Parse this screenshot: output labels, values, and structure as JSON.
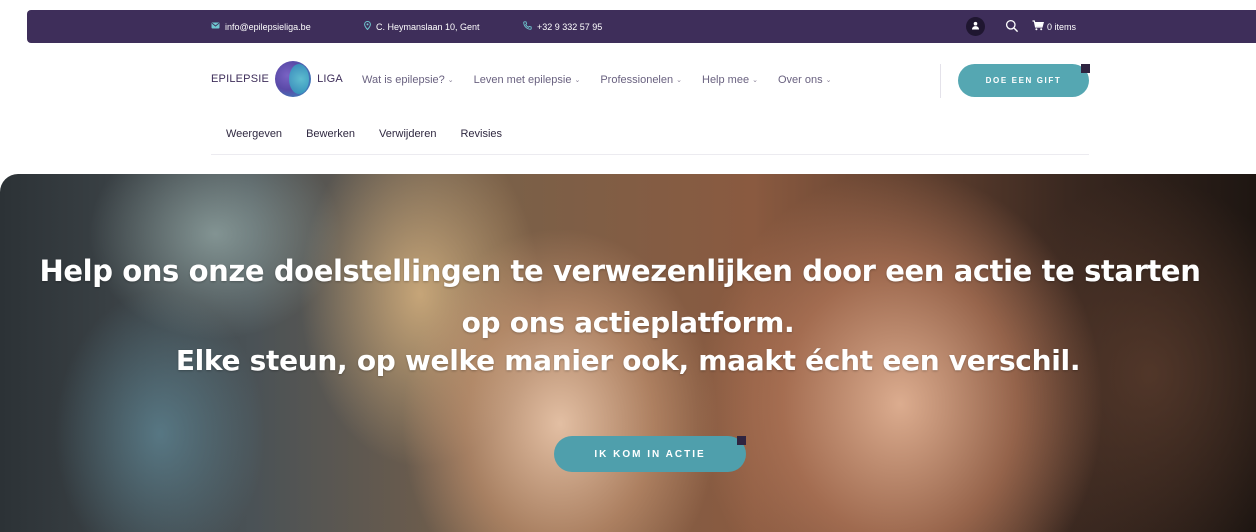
{
  "topbar": {
    "email": "info@epilepsieliga.be",
    "address": "C. Heymanslaan 10, Gent",
    "phone": "+32 9 332 57 95",
    "cart_label": "0 items",
    "icons": {
      "email": "mail-icon",
      "address": "location-pin-icon",
      "phone": "phone-icon",
      "account": "user-icon",
      "search": "search-icon",
      "cart": "cart-icon"
    }
  },
  "header": {
    "logo_left": "EPILEPSIE",
    "logo_right": "LIGA",
    "nav": [
      {
        "label": "Wat is epilepsie?"
      },
      {
        "label": "Leven met epilepsie"
      },
      {
        "label": "Professionelen"
      },
      {
        "label": "Help mee"
      },
      {
        "label": "Over ons"
      }
    ],
    "gift_button": "DOE EEN GIFT"
  },
  "admin_tabs": [
    "Weergeven",
    "Bewerken",
    "Verwijderen",
    "Revisies"
  ],
  "hero": {
    "line1": "Help ons onze doelstellingen te verwezenlijken door een actie te starten",
    "line2": "op ons actieplatform.",
    "line3": "Elke steun, op welke manier ook, maakt écht een verschil.",
    "cta": "IK KOM IN ACTIE"
  },
  "colors": {
    "topbar_bg": "#3e2e5a",
    "accent_teal": "#55a7b2",
    "corner_dark": "#2f2440"
  }
}
